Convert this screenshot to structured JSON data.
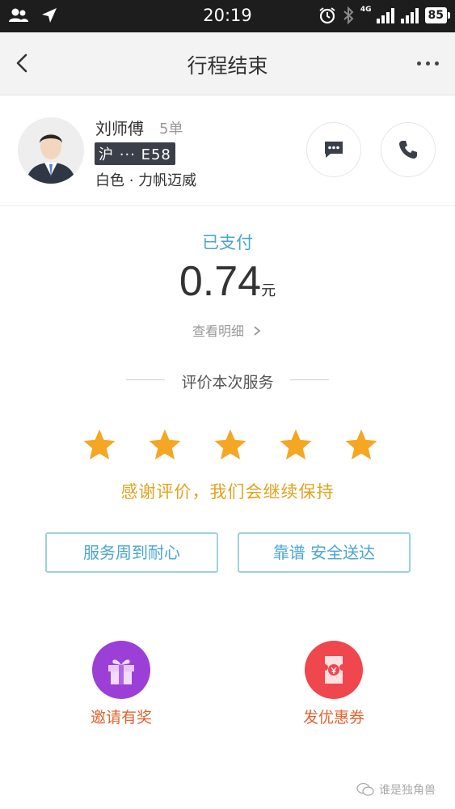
{
  "status_bar": {
    "time": "20:19",
    "network": "4G",
    "battery": "85",
    "icons": [
      "contacts-icon",
      "location-arrow-icon",
      "alarm-icon",
      "bluetooth-icon",
      "signal-icon",
      "wifi-signal-icon",
      "battery-icon"
    ]
  },
  "nav": {
    "title": "行程结束",
    "back_icon": "chevron-left-icon",
    "more_icon": "more-dots-icon"
  },
  "driver": {
    "name": "刘师傅",
    "orders": "5单",
    "plate": "沪 ··· E58",
    "car": "白色 · 力帆迈威",
    "message_icon": "chat-bubble-icon",
    "call_icon": "phone-icon"
  },
  "payment": {
    "status": "已支付",
    "amount": "0.74",
    "unit": "元",
    "detail_link": "查看明细"
  },
  "rating": {
    "title": "评价本次服务",
    "stars": 5,
    "max_stars": 5,
    "thanks": "感谢评价，我们会继续保持",
    "tags": [
      "服务周到耐心",
      "靠谱 安全送达"
    ],
    "star_color": "#f5a623",
    "accent_color": "#4aa6cf"
  },
  "promotions": [
    {
      "label": "邀请有奖",
      "icon": "gift-icon",
      "color": "#9b3fd6"
    },
    {
      "label": "发优惠券",
      "icon": "coupon-icon",
      "color": "#f0464d"
    }
  ],
  "watermark": "谁是独角兽"
}
